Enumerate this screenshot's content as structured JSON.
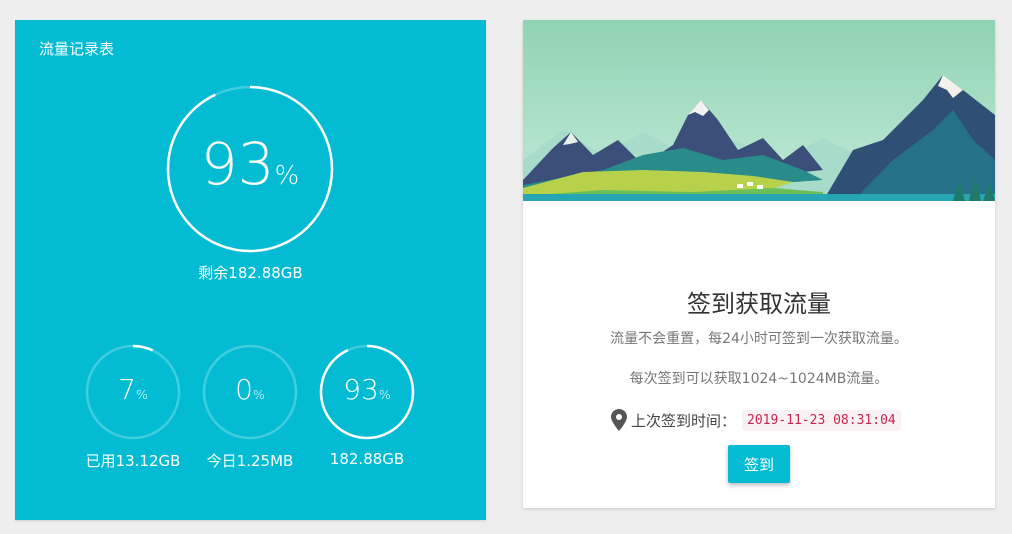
{
  "traffic_card": {
    "title": "流量记录表",
    "accent_color": "#03bcd4",
    "remaining": {
      "percent_value": "93",
      "percent_sign": "%",
      "fraction": 0.93,
      "label": "剩余182.88GB"
    },
    "stats": [
      {
        "percent_value": "7",
        "percent_sign": "%",
        "fraction": 0.07,
        "label": "已用13.12GB"
      },
      {
        "percent_value": "0",
        "percent_sign": "%",
        "fraction": 0.0,
        "label": "今日1.25MB"
      },
      {
        "percent_value": "93",
        "percent_sign": "%",
        "fraction": 0.93,
        "label": "182.88GB"
      }
    ]
  },
  "checkin_card": {
    "banner_image": "mountain-landscape",
    "heading": "签到获取流量",
    "desc_reset": "流量不会重置，每24小时可签到一次获取流量。",
    "desc_range": "每次签到可以获取1024~1024MB流量。",
    "last_checkin_icon": "map-pin-icon",
    "last_checkin_label": "上次签到时间：",
    "last_checkin_time": "2019-11-23 08:31:04",
    "button_label": "签到"
  }
}
